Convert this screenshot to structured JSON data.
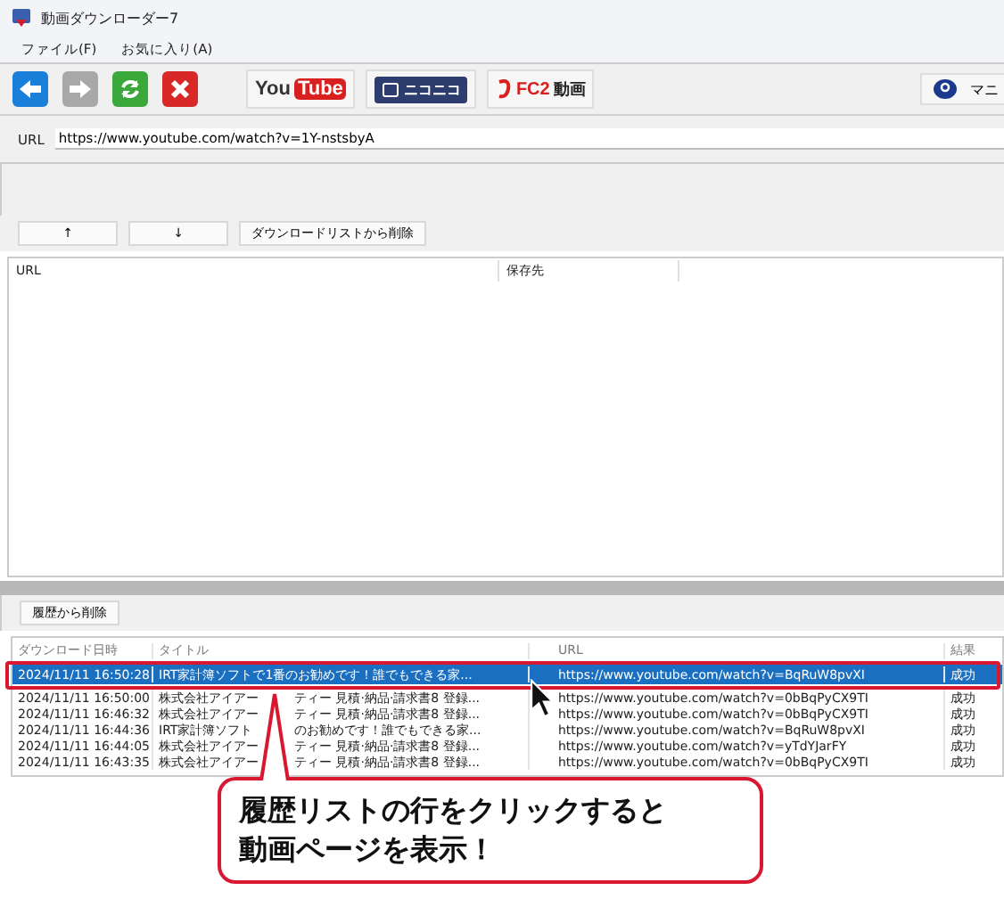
{
  "window": {
    "title": "動画ダウンローダー7"
  },
  "menu": [
    "ファイル(F)",
    "お気に入り(A)"
  ],
  "toolbar": {
    "sites": [
      {
        "kind": "youtube",
        "parts": [
          "You",
          "Tube"
        ]
      },
      {
        "kind": "niconico",
        "parts": [
          "ニコニコ"
        ]
      },
      {
        "kind": "fc2",
        "parts": [
          "FC2",
          "動画"
        ]
      }
    ],
    "help": "マニ"
  },
  "url_bar": {
    "label": "URL",
    "value": "https://www.youtube.com/watch?v=1Y-nstsbyA"
  },
  "download_buttons": [
    "↑",
    "↓",
    "ダウンロードリストから削除"
  ],
  "download_list": {
    "columns": [
      "URL",
      "保存先"
    ]
  },
  "history_button": "履歴から削除",
  "history": {
    "columns": [
      "ダウンロード日時",
      "タイトル",
      "URL",
      "結果"
    ],
    "rows": [
      {
        "selected": true,
        "cells": [
          "2024/11/11 16:50:28",
          "IRT家計簿ソフトで1番のお勧めです！誰でもできる家...",
          "https://www.youtube.com/watch?v=BqRuW8pvXI",
          "成功"
        ]
      },
      {
        "selected": false,
        "cells": [
          "2024/11/11 16:50:00",
          [
            "株式会社アイアー",
            "ティー 見積·納品·請求書8 登録..."
          ],
          "https://www.youtube.com/watch?v=0bBqPyCX9TI",
          "成功"
        ]
      },
      {
        "selected": false,
        "cells": [
          "2024/11/11 16:46:32",
          [
            "株式会社アイアー",
            "ティー 見積·納品·請求書8 登録..."
          ],
          "https://www.youtube.com/watch?v=0bBqPyCX9TI",
          "成功"
        ]
      },
      {
        "selected": false,
        "cells": [
          "2024/11/11 16:44:36",
          [
            "IRT家計簿ソフト",
            "のお勧めです！誰でもできる家..."
          ],
          "https://www.youtube.com/watch?v=BqRuW8pvXI",
          "成功"
        ]
      },
      {
        "selected": false,
        "cells": [
          "2024/11/11 16:44:05",
          [
            "株式会社アイアー",
            "ティー 見積·納品·請求書8 登録..."
          ],
          "https://www.youtube.com/watch?v=yTdYJarFY",
          "成功"
        ]
      },
      {
        "selected": false,
        "cells": [
          "2024/11/11 16:43:35",
          [
            "株式会社アイアー",
            "ティー 見積·納品·請求書8 登録..."
          ],
          "https://www.youtube.com/watch?v=0bBqPyCX9TI",
          "成功"
        ]
      }
    ]
  },
  "callout": {
    "lines": [
      "履歴リストの行をクリックすると",
      "動画ページを表示！"
    ]
  }
}
